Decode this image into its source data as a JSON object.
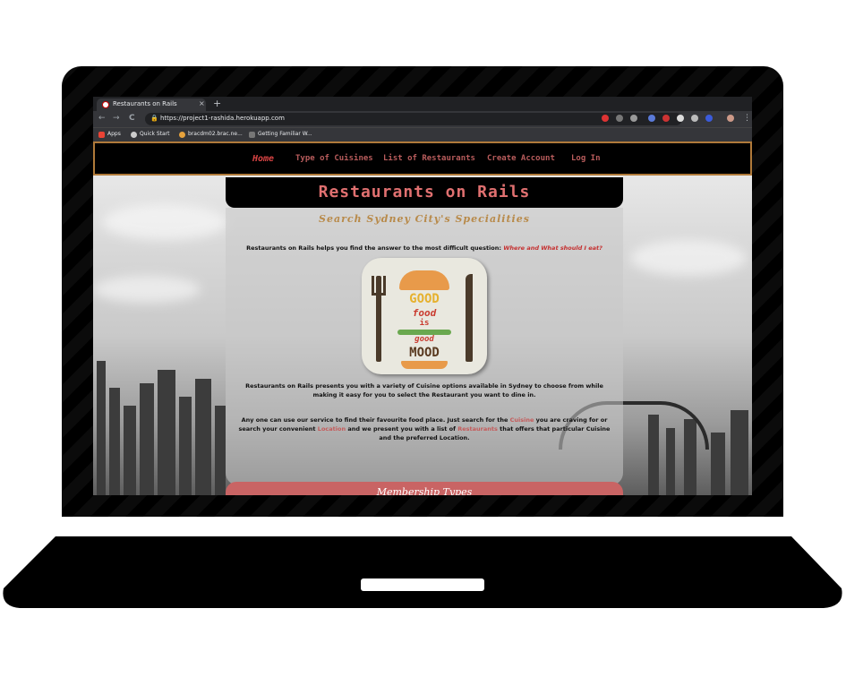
{
  "browser": {
    "tab_title": "Restaurants on Rails",
    "tab_close": "×",
    "new_tab": "+",
    "back": "←",
    "forward": "→",
    "reload": "C",
    "url": "https://project1-rashida.herokuapp.com",
    "bookmarks": [
      "Apps",
      "Quick Start",
      "bracdm02.brac.ne...",
      "Getting Familiar W..."
    ]
  },
  "site": {
    "nav": [
      "Home",
      "Type of Cuisines",
      "List of Restaurants",
      "Create Account",
      "Log In"
    ],
    "active_nav": "Home",
    "title": "Restaurants on Rails",
    "subtitle": "Search Sydney City's Specialities",
    "intro": "Restaurants on Rails helps you find the answer to the most difficult question:",
    "intro_question": "Where and What should I eat?",
    "logo": {
      "line1": "GOOD",
      "line2": "food",
      "line3": "is",
      "line4": "good",
      "line5": "MOOD"
    },
    "para1_line1": "Restaurants on Rails presents you with a variety of Cuisine options available in Sydney to choose from while",
    "para1_line2": "making it easy for you to select the Restaurant you want to dine in.",
    "para2_a": "Any one can use our service to find their favourite food place. Just search for the",
    "para2_cuisine": "Cuisine",
    "para2_b": "you are craving for or",
    "para2_c": "search your convenient",
    "para2_location": "Location",
    "para2_d": "and we present you with a list of",
    "para2_restaurants": "Restaurants",
    "para2_e": "that offers that particular Cuisine",
    "para2_f": "and the preferred Location.",
    "membership": "Membership Types"
  },
  "colors": {
    "accent": "#c96464",
    "nav_border": "#b07a3a",
    "subtitle": "#b88a4a"
  }
}
